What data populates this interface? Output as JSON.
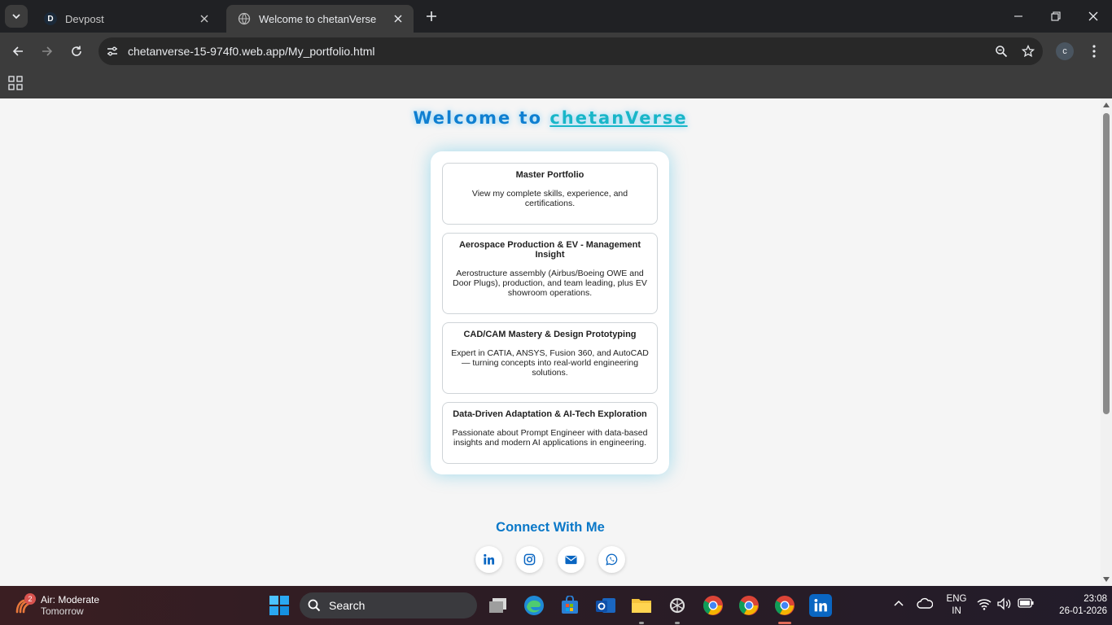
{
  "browser": {
    "tabs": [
      {
        "title": "Devpost",
        "favicon": "D",
        "active": false
      },
      {
        "title": "Welcome to chetanVerse",
        "active": true
      }
    ],
    "url": "chetanverse-15-974f0.web.app/My_portfolio.html",
    "profile_initial": "c"
  },
  "page": {
    "welcome_prefix": "Welcome to",
    "welcome_brand": "chetanVerse",
    "cards": [
      {
        "title": "Master Portfolio",
        "desc": "View my complete skills, experience, and certifications."
      },
      {
        "title": "Aerospace Production & EV - Management Insight",
        "desc": "Aerostructure assembly (Airbus/Boeing OWE and Door Plugs), production, and team leading, plus EV showroom operations."
      },
      {
        "title": "CAD/CAM Mastery & Design Prototyping",
        "desc": "Expert in CATIA, ANSYS, Fusion 360, and AutoCAD — turning concepts into real-world engineering solutions."
      },
      {
        "title": "Data-Driven Adaptation & AI-Tech Exploration",
        "desc": "Passionate about Prompt Engineer with data-based insights and modern AI applications in engineering."
      }
    ],
    "connect_title": "Connect With Me",
    "socials": [
      "linkedin-icon",
      "instagram-icon",
      "email-icon",
      "whatsapp-icon"
    ],
    "accent_color": "#0a78c8"
  },
  "taskbar": {
    "weather_badge": "2",
    "weather_title": "Air: Moderate",
    "weather_sub": "Tomorrow",
    "search_label": "Search",
    "lang_line1": "ENG",
    "lang_line2": "IN",
    "time": "23:08",
    "date": "26-01-2026",
    "profile_badge": "c"
  }
}
